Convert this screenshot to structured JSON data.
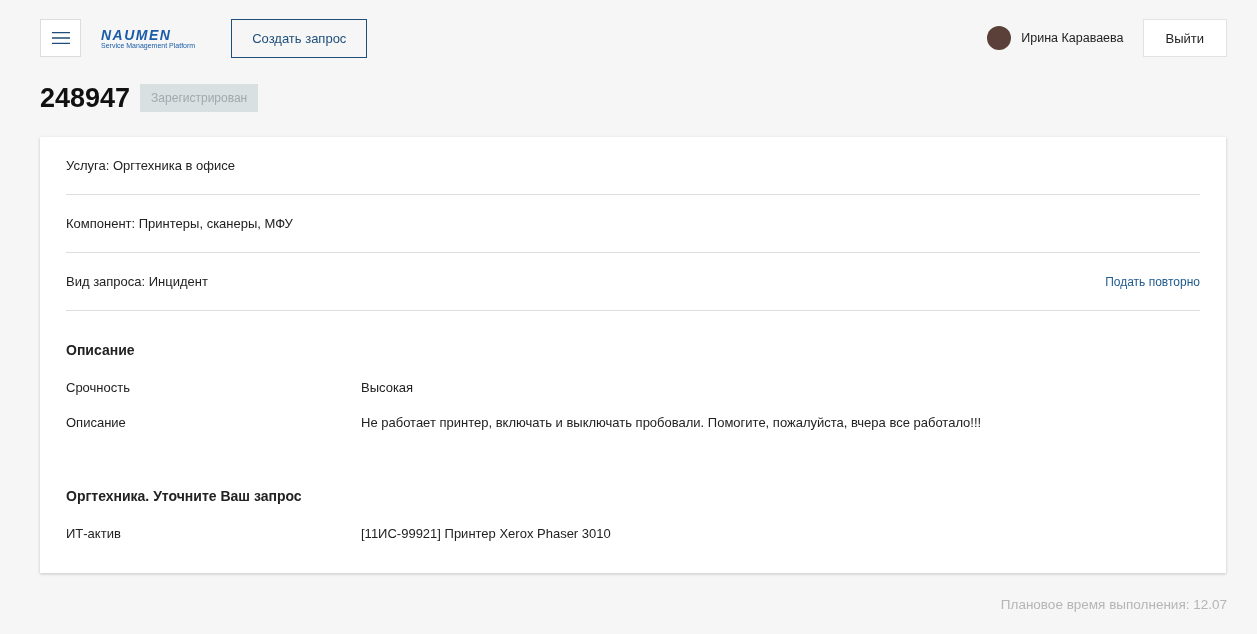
{
  "header": {
    "logo": {
      "name": "NAUMEN",
      "tagline": "Service Management Platform"
    },
    "create_button": "Создать запрос",
    "user": {
      "name": "Ирина Караваева"
    },
    "logout_button": "Выйти"
  },
  "request": {
    "number": "248947",
    "status": "Зарегистрирован"
  },
  "summary_rows": [
    {
      "text": "Услуга: Оргтехника в офисе"
    },
    {
      "text": "Компонент: Принтеры, сканеры, МФУ"
    },
    {
      "text": "Вид запроса: Инцидент",
      "link": "Подать повторно"
    }
  ],
  "sections": [
    {
      "title": "Описание",
      "fields": [
        {
          "label": "Срочность",
          "value": "Высокая"
        },
        {
          "label": "Описание",
          "value": "Не работает принтер, включать и выключать пробовали. Помогите, пожалуйста, вчера все работало!!!"
        }
      ]
    },
    {
      "title": "Оргтехника. Уточните Ваш запрос",
      "fields": [
        {
          "label": "ИТ-актив",
          "value": "[11ИС-99921] Принтер Xerox Phaser 3010"
        }
      ]
    }
  ],
  "footer": "Плановое время выполнения: 12.07"
}
